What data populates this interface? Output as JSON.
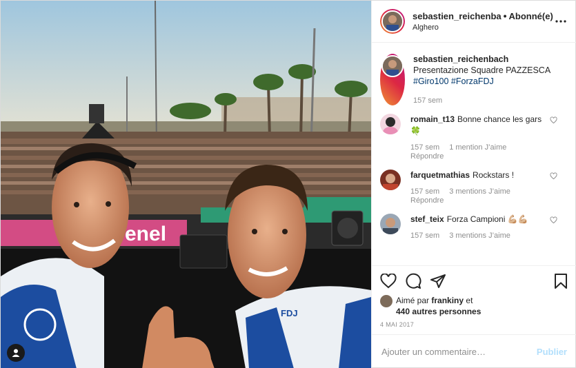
{
  "header": {
    "username": "sebastien_reichenba",
    "separator": "•",
    "follow_label": "Abonné(e)",
    "location": "Alghero",
    "more_label": "•••"
  },
  "caption": {
    "username": "sebastien_reichenbach",
    "text": "Presentazione Squadre PAZZESCA",
    "hashtag1": "#Giro100",
    "hashtag2": "#ForzaFDJ",
    "age": "157 sem"
  },
  "comments": [
    {
      "username": "romain_t13",
      "text": "Bonne chance les gars",
      "emoji": "🍀",
      "age": "157 sem",
      "likes": "1 mention J’aime",
      "reply": "Répondre",
      "avatar_color": "#e98fb6"
    },
    {
      "username": "farquetmathias",
      "text": "Rockstars !",
      "emoji": "",
      "age": "157 sem",
      "likes": "3 mentions J’aime",
      "reply": "Répondre",
      "avatar_color": "#c0442e"
    },
    {
      "username": "stef_teix",
      "text": "Forza Campioni",
      "emoji": "💪🏼💪🏼",
      "age": "157 sem",
      "likes": "3 mentions J’aime",
      "reply": "",
      "avatar_color": "#6b7f96"
    }
  ],
  "likes": {
    "prefix": "Aimé par",
    "liker": "frankiny",
    "conj": "et",
    "others": "440 autres personnes"
  },
  "date": "4 MAI 2017",
  "add_comment": {
    "placeholder": "Ajouter un commentaire…",
    "publish_label": "Publier"
  },
  "photo": {
    "banner_text": "enel",
    "jersey_text": "FDJ"
  }
}
